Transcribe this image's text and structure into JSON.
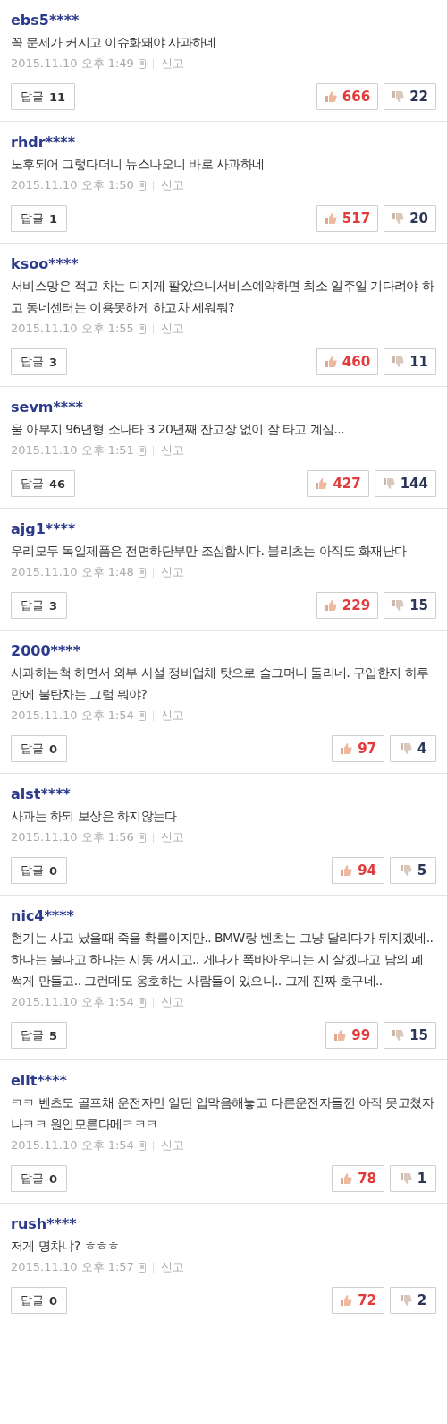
{
  "comments": [
    {
      "user": "ebs5****",
      "text": "꼭 문제가 커지고 이슈화돼야 사과하네",
      "time": "2015.11.10 오후 1:49",
      "report": "신고",
      "reply_label": "답글",
      "reply_count": "11",
      "likes": "666",
      "dislikes": "22"
    },
    {
      "user": "rhdr****",
      "text": "노후되어 그렇다더니 뉴스나오니 바로 사과하네",
      "time": "2015.11.10 오후 1:50",
      "report": "신고",
      "reply_label": "답글",
      "reply_count": "1",
      "likes": "517",
      "dislikes": "20"
    },
    {
      "user": "ksoo****",
      "text": "서비스망은 적고 차는 디지게 팔았으니서비스예약하면 최소 일주일 기다려야 하고 동네센터는 이용못하게 하고차 세워둬?",
      "time": "2015.11.10 오후 1:55",
      "report": "신고",
      "reply_label": "답글",
      "reply_count": "3",
      "likes": "460",
      "dislikes": "11"
    },
    {
      "user": "sevm****",
      "text": "울 아부지 96년형 소나타 3 20년째 잔고장 없이 잘 타고 계심...",
      "time": "2015.11.10 오후 1:51",
      "report": "신고",
      "reply_label": "답글",
      "reply_count": "46",
      "likes": "427",
      "dislikes": "144"
    },
    {
      "user": "ajg1****",
      "text": "우리모두 독일제품은 전면하단부만 조심합시다. 블리츠는 아직도 화재난다",
      "time": "2015.11.10 오후 1:48",
      "report": "신고",
      "reply_label": "답글",
      "reply_count": "3",
      "likes": "229",
      "dislikes": "15"
    },
    {
      "user": "2000****",
      "text": "사과하는척 하면서 외부 사설 정비업체 탓으로 슬그머니 돌리네. 구입한지 하루만에 불탄차는 그럼 뭐야?",
      "time": "2015.11.10 오후 1:54",
      "report": "신고",
      "reply_label": "답글",
      "reply_count": "0",
      "likes": "97",
      "dislikes": "4"
    },
    {
      "user": "alst****",
      "text": "사과는 하되 보상은 하지않는다",
      "time": "2015.11.10 오후 1:56",
      "report": "신고",
      "reply_label": "답글",
      "reply_count": "0",
      "likes": "94",
      "dislikes": "5"
    },
    {
      "user": "nic4****",
      "text": "현기는 사고 났을때 죽을 확률이지만.. BMW랑 벤츠는 그냥 달리다가 뒤지겠네.. 하나는 불나고 하나는 시동 꺼지고.. 게다가 폭바아우디는 지 살겠다고 남의 폐 썩게 만들고.. 그런데도 옹호하는 사람들이 있으니.. 그게 진짜 호구네..",
      "time": "2015.11.10 오후 1:54",
      "report": "신고",
      "reply_label": "답글",
      "reply_count": "5",
      "likes": "99",
      "dislikes": "15"
    },
    {
      "user": "elit****",
      "text": "ㅋㅋ 벤츠도 골프채 운전자만 일단 입막음해놓고 다른운전자들껀 아직 못고쳤자나ㅋㅋ 원인모른다메ㅋㅋㅋ",
      "time": "2015.11.10 오후 1:54",
      "report": "신고",
      "reply_label": "답글",
      "reply_count": "0",
      "likes": "78",
      "dislikes": "1"
    },
    {
      "user": "rush****",
      "text": "저게 명차냐? ㅎㅎㅎ",
      "time": "2015.11.10 오후 1:57",
      "report": "신고",
      "reply_label": "답글",
      "reply_count": "0",
      "likes": "72",
      "dislikes": "2"
    }
  ]
}
